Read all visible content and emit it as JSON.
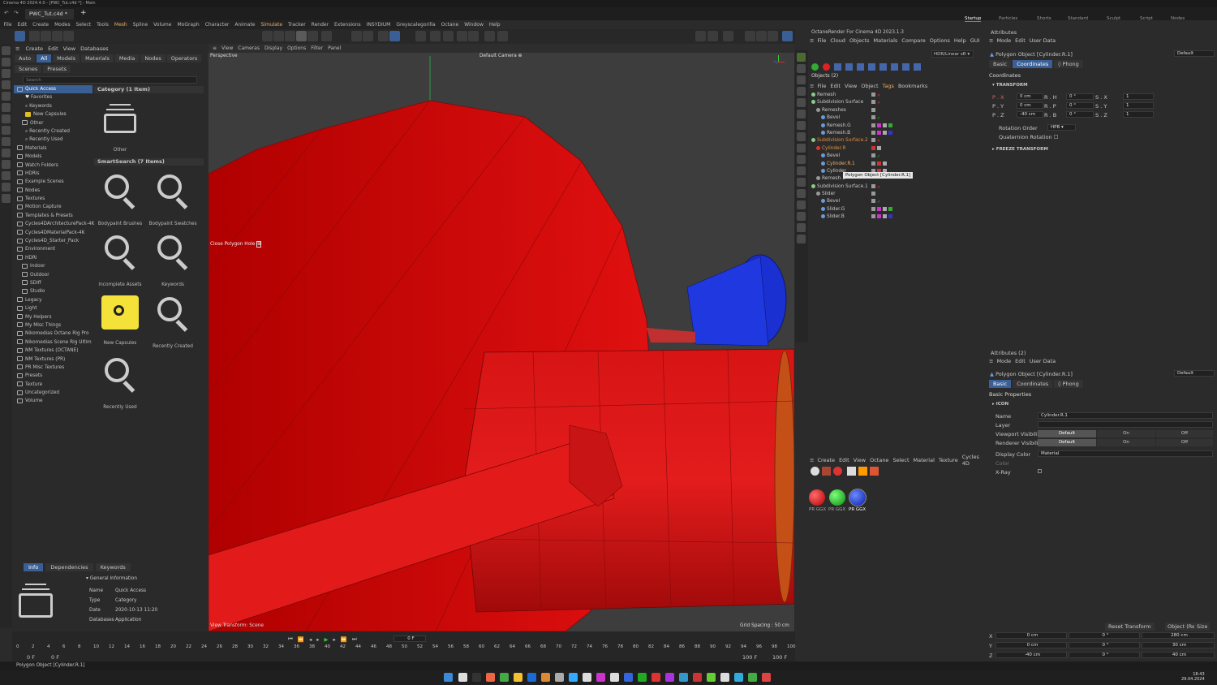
{
  "window_title": "Cinema 4D 2024.4.0 - [PWC_Tut.c4d *] - Main",
  "doc_tab": "PWC_Tut.c4d *",
  "layouts": [
    "Startup",
    "Particles",
    "Sculpt",
    "Standard",
    "Sculpt",
    "Script",
    "Nodes"
  ],
  "menu": [
    "File",
    "Edit",
    "Create",
    "Modes",
    "Select",
    "Tools",
    "Mesh",
    "Spline",
    "Volume",
    "MoGraph",
    "Character",
    "Animate",
    "Simulate",
    "Tracker",
    "Render",
    "Extensions",
    "INSYDIUM",
    "Greyscalegorilla",
    "Octane",
    "Window",
    "Help"
  ],
  "asset_browser": {
    "menu": [
      "Create",
      "Edit",
      "View",
      "Databases"
    ],
    "filters": [
      "Auto",
      "All",
      "Models",
      "Materials",
      "Media",
      "Nodes",
      "Operators"
    ],
    "subtabs": [
      "Scenes",
      "Presets"
    ],
    "search_placeholder": "Search",
    "tree": [
      "Quick Access",
      "Favorites",
      "Keywords",
      "New Capsules",
      "Other",
      "Recently Created",
      "Recently Used",
      "Materials",
      "Models",
      "Watch Folders",
      "HDRIs",
      "Example Scenes",
      "Nodes",
      "Textures",
      "Motion Capture",
      "Templates & Presets",
      "Cycles4DArchitecturePack-4K",
      "Cycles4DMaterialPack-4K",
      "Cycles4D_Starter_Pack",
      "Environment",
      "HDRI",
      "Indoor",
      "Outdoor",
      "SDiff",
      "Studio",
      "Legacy",
      "Light",
      "My Helpers",
      "My Misc Things",
      "Nikomedias Octane Rig Pro",
      "Nikomedias Scene Rig Ultim",
      "NM Textures (OCTANE)",
      "NM Textures (PR)",
      "PR Misc Textures",
      "Presets",
      "Texture",
      "Uncategorized",
      "Volume"
    ],
    "category_header": "Category (1 Item)",
    "category_item": "Other",
    "smartsearch_header": "SmartSearch (7 Items)",
    "smart_items": [
      "Bodypaint Brushes",
      "Bodypaint Swatches",
      "Incomplete Assets",
      "Keywords",
      "New Capsules",
      "Recently Created",
      "Recently Used"
    ]
  },
  "info_panel": {
    "tabs": [
      "Info",
      "Dependencies",
      "Keywords"
    ],
    "section": "General Information",
    "rows": [
      [
        "Name",
        "Quick Access"
      ],
      [
        "Type",
        "Category"
      ],
      [
        "Date",
        "2020-10-13 11:20"
      ],
      [
        "Databases",
        "Application"
      ]
    ]
  },
  "viewport": {
    "menu": [
      "View",
      "Cameras",
      "Display",
      "Options",
      "Filter",
      "Panel"
    ],
    "label": "Perspective",
    "camera": "Default Camera",
    "tooltip": "Close Polygon Hole",
    "view_transform": "View Transform: Scene",
    "grid": "Grid Spacing : 50 cm"
  },
  "octane_header": "OctaneRender For Cinema 4D 2023.1.3",
  "octane_menu": [
    "File",
    "Cloud",
    "Objects",
    "Materials",
    "Compare",
    "Options",
    "Help",
    "GUI"
  ],
  "octane_mode": "HDR/Linear sR",
  "objects": {
    "title": "Objects (2)",
    "menu": [
      "File",
      "Edit",
      "View",
      "Object",
      "Tags",
      "Bookmarks"
    ],
    "items": [
      "Remesh",
      "Subdivision Surface",
      "Remeshes",
      "Bevel",
      "Remesh.G",
      "Remesh.B",
      "Subdivision Surface.2",
      "Cylinder.R",
      "Bevel",
      "Cylinder.R.1",
      "Cylinder",
      "Remesh.1",
      "Subdivision Surface.1",
      "Slider",
      "Bevel",
      "Slider.G",
      "Slider.B"
    ],
    "tooltip": "Polygon Object [Cylinder.R.1]"
  },
  "materials": {
    "menu": [
      "Create",
      "Edit",
      "View",
      "Octane",
      "Select",
      "Material",
      "Texture",
      "Cycles 4D"
    ],
    "items": [
      "PR GGX",
      "PR GGX",
      "PR GGX"
    ],
    "colors": [
      "#d81818",
      "#20b020",
      "#1a3ad8"
    ]
  },
  "attributes": {
    "title": "Attributes",
    "menu": [
      "Mode",
      "Edit",
      "User Data"
    ],
    "object": "Polygon Object [Cylinder.R.1]",
    "preset": "Default",
    "tabs": [
      "Basic",
      "Coordinates",
      "Phong"
    ],
    "section": "Coordinates",
    "transform": "TRANSFORM",
    "px": "0 cm",
    "py": "0 cm",
    "pz": "-40 cm",
    "rh": "0 °",
    "rp": "0 °",
    "rb": "0 °",
    "sx": "1",
    "sy": "1",
    "sz": "1",
    "rot_order_label": "Rotation Order",
    "rot_order": "HPB",
    "quat": "Quaternion Rotation",
    "freeze": "FREEZE TRANSFORM"
  },
  "attributes2": {
    "title": "Attributes (2)",
    "section": "Basic Properties",
    "icon": "ICON",
    "name_label": "Name",
    "name": "Cylinder.R.1",
    "layer_label": "Layer",
    "vv_label": "Viewport Visibility",
    "rv_label": "Renderer Visibility",
    "vis": [
      "Default",
      "On",
      "Off"
    ],
    "dc_label": "Display Color",
    "dc": "Material",
    "color_label": "Color",
    "xray_label": "X-Ray"
  },
  "coords": {
    "reset": "Reset Transform",
    "mode": "Object (Rel)",
    "size": "Size",
    "rows": [
      [
        "X",
        "0 cm",
        "0 °",
        "280 cm"
      ],
      [
        "Y",
        "0 cm",
        "0 °",
        "30 cm"
      ],
      [
        "Z",
        "-40 cm",
        "0 °",
        "40 cm"
      ]
    ]
  },
  "timeline": {
    "frame": "0 F",
    "ticks": [
      "0",
      "2",
      "4",
      "6",
      "8",
      "10",
      "12",
      "14",
      "16",
      "18",
      "20",
      "22",
      "24",
      "26",
      "28",
      "30",
      "32",
      "34",
      "36",
      "38",
      "40",
      "42",
      "44",
      "46",
      "48",
      "50",
      "52",
      "54",
      "56",
      "58",
      "60",
      "62",
      "64",
      "66",
      "68",
      "70",
      "72",
      "74",
      "76",
      "78",
      "80",
      "82",
      "84",
      "86",
      "88",
      "90",
      "92",
      "94",
      "96",
      "98",
      "100"
    ],
    "start": "0 F",
    "start2": "0 F",
    "end": "100 F",
    "end2": "100 F"
  },
  "status": "Polygon Object [Cylinder.R.1]",
  "clock": {
    "time": "18:43",
    "date": "29.04.2024"
  }
}
